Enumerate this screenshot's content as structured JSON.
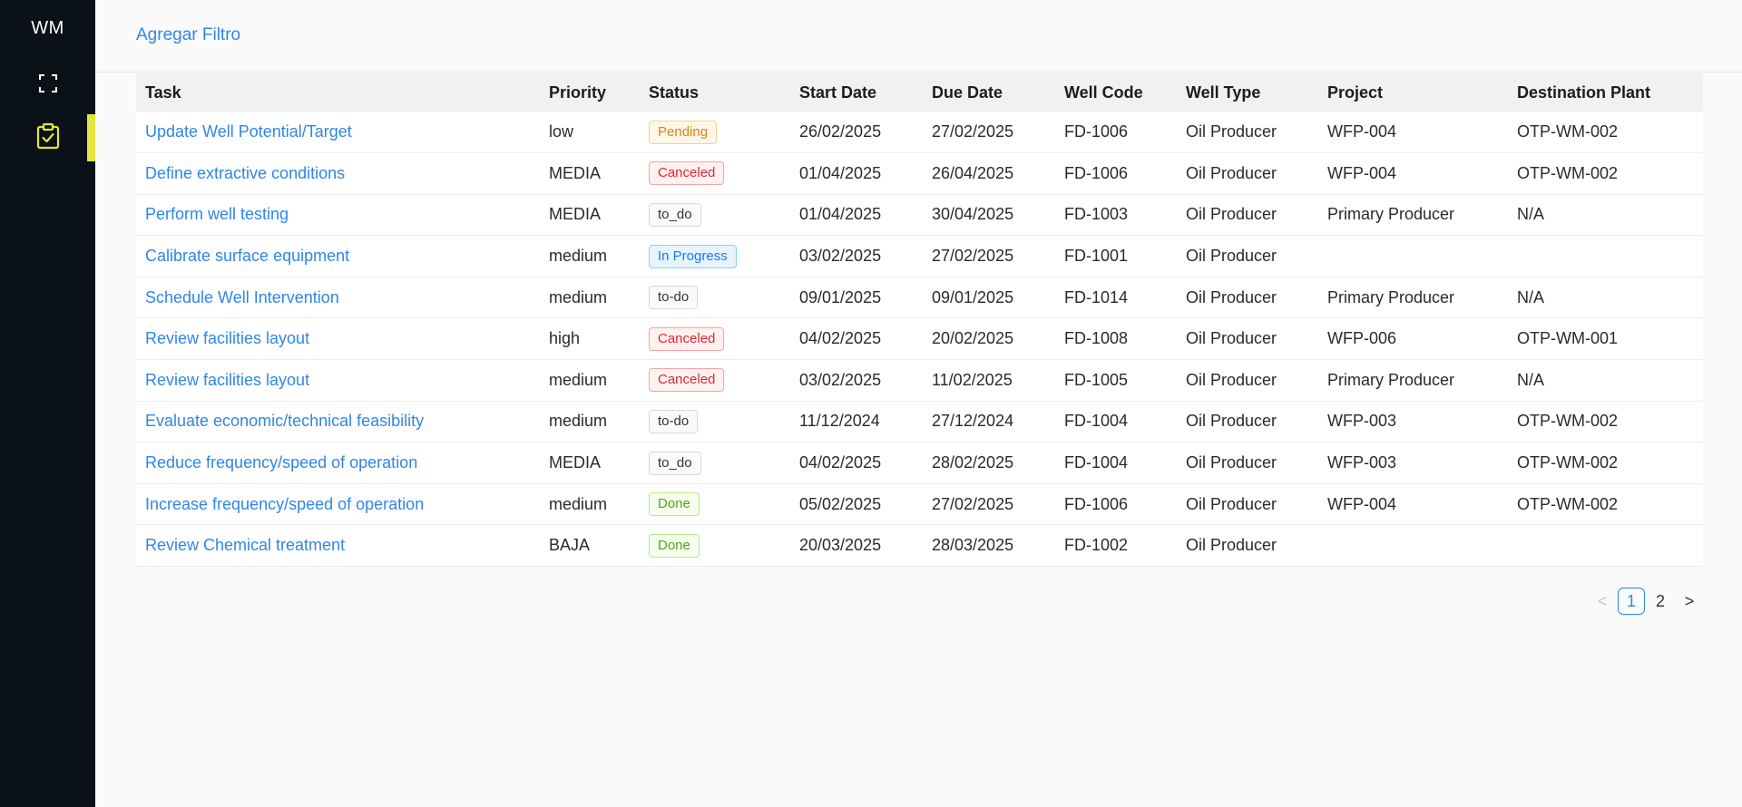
{
  "sidebar": {
    "logo": "WM",
    "items": [
      {
        "name": "expand-icon"
      },
      {
        "name": "clipboard-check-icon",
        "active": true
      }
    ],
    "accent_color": "#e2e63f"
  },
  "toolbar": {
    "add_filter_label": "Agregar Filtro"
  },
  "table": {
    "columns": [
      "Task",
      "Priority",
      "Status",
      "Start Date",
      "Due Date",
      "Well Code",
      "Well Type",
      "Project",
      "Destination Plant"
    ],
    "rows": [
      {
        "task": "Update Well Potential/Target",
        "priority": "low",
        "status": "Pending",
        "status_type": "pending",
        "start": "26/02/2025",
        "due": "27/02/2025",
        "well_code": "FD-1006",
        "well_type": "Oil Producer",
        "project": "WFP-004",
        "plant": "OTP-WM-002"
      },
      {
        "task": "Define extractive conditions",
        "priority": "MEDIA",
        "status": "Canceled",
        "status_type": "canceled",
        "start": "01/04/2025",
        "due": "26/04/2025",
        "well_code": "FD-1006",
        "well_type": "Oil Producer",
        "project": "WFP-004",
        "plant": "OTP-WM-002"
      },
      {
        "task": "Perform well testing",
        "priority": "MEDIA",
        "status": "to_do",
        "status_type": "neutral",
        "start": "01/04/2025",
        "due": "30/04/2025",
        "well_code": "FD-1003",
        "well_type": "Oil Producer",
        "project": "Primary Producer",
        "plant": "N/A"
      },
      {
        "task": "Calibrate surface equipment",
        "priority": "medium",
        "status": "In Progress",
        "status_type": "progress",
        "start": "03/02/2025",
        "due": "27/02/2025",
        "well_code": "FD-1001",
        "well_type": "Oil Producer",
        "project": "",
        "plant": ""
      },
      {
        "task": "Schedule Well Intervention",
        "priority": "medium",
        "status": "to-do",
        "status_type": "neutral",
        "start": "09/01/2025",
        "due": "09/01/2025",
        "well_code": "FD-1014",
        "well_type": "Oil Producer",
        "project": "Primary Producer",
        "plant": "N/A"
      },
      {
        "task": "Review facilities layout",
        "priority": "high",
        "status": "Canceled",
        "status_type": "canceled",
        "start": "04/02/2025",
        "due": "20/02/2025",
        "well_code": "FD-1008",
        "well_type": "Oil Producer",
        "project": "WFP-006",
        "plant": "OTP-WM-001"
      },
      {
        "task": "Review facilities layout",
        "priority": "medium",
        "status": "Canceled",
        "status_type": "canceled",
        "start": "03/02/2025",
        "due": "11/02/2025",
        "well_code": "FD-1005",
        "well_type": "Oil Producer",
        "project": "Primary Producer",
        "plant": "N/A"
      },
      {
        "task": "Evaluate economic/technical feasibility",
        "priority": "medium",
        "status": "to-do",
        "status_type": "neutral",
        "start": "11/12/2024",
        "due": "27/12/2024",
        "well_code": "FD-1004",
        "well_type": "Oil Producer",
        "project": "WFP-003",
        "plant": "OTP-WM-002"
      },
      {
        "task": "Reduce frequency/speed of operation",
        "priority": "MEDIA",
        "status": "to_do",
        "status_type": "neutral",
        "start": "04/02/2025",
        "due": "28/02/2025",
        "well_code": "FD-1004",
        "well_type": "Oil Producer",
        "project": "WFP-003",
        "plant": "OTP-WM-002"
      },
      {
        "task": "Increase frequency/speed of operation",
        "priority": "medium",
        "status": "Done",
        "status_type": "done",
        "start": "05/02/2025",
        "due": "27/02/2025",
        "well_code": "FD-1006",
        "well_type": "Oil Producer",
        "project": "WFP-004",
        "plant": "OTP-WM-002"
      },
      {
        "task": "Review Chemical treatment",
        "priority": "BAJA",
        "status": "Done",
        "status_type": "done",
        "start": "20/03/2025",
        "due": "28/03/2025",
        "well_code": "FD-1002",
        "well_type": "Oil Producer",
        "project": "",
        "plant": ""
      }
    ]
  },
  "pagination": {
    "prev": "<",
    "pages": [
      "1",
      "2"
    ],
    "current": "1",
    "next": ">"
  },
  "colors": {
    "link": "#2f86e8",
    "sidebar_bg": "#0b1119"
  }
}
